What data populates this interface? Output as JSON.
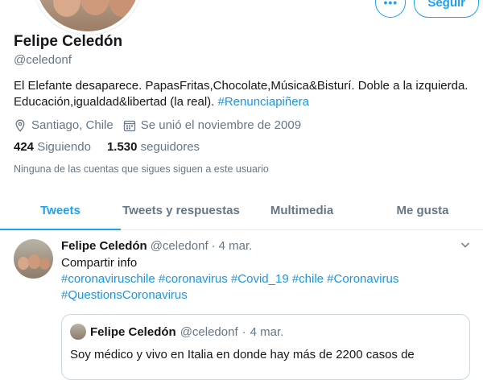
{
  "profile": {
    "name": "Felipe Celedón",
    "handle": "@celedonf",
    "bio_text": "El Elefante desaparece. PapasFritas,Chocolate,Música&Bisturí. Doble a la izquierda. Educación,igualdad&libertad (la real).",
    "bio_hashtag": "#Renunciapiñera",
    "location": "Santiago, Chile",
    "joined": "Se unió el noviembre de 2009",
    "following_count": "424",
    "following_label": "Siguiendo",
    "followers_count": "1.530",
    "followers_label": "seguidores",
    "followers_note": "Ninguna de las cuentas que sigues siguen a este usuario"
  },
  "actions": {
    "more_label": "•••",
    "follow_label": "Seguir"
  },
  "tabs": [
    {
      "label": "Tweets",
      "active": true
    },
    {
      "label": "Tweets y respuestas",
      "active": false
    },
    {
      "label": "Multimedia",
      "active": false
    },
    {
      "label": "Me gusta",
      "active": false
    }
  ],
  "tweet": {
    "name": "Felipe Celedón",
    "handle": "@celedonf",
    "separator": "·",
    "date": "4 mar.",
    "text": "Compartir info",
    "hashtags_line1": "#coronaviruschile #coronavirus #Covid_19 #chile #Coronavirus",
    "hashtags_line2": "#QuestionsCoronavirus",
    "quote": {
      "name": "Felipe Celedón",
      "handle": "@celedonf",
      "separator": "·",
      "date": "4 mar.",
      "text": "Soy médico y vivo en Italia en donde hay más de 2200 casos de"
    }
  },
  "colors": {
    "accent": "#1da1f2",
    "link": "#1b95e0",
    "muted": "#657786",
    "text": "#14171a",
    "border": "#e6ecf0"
  },
  "icons": [
    "location-pin-icon",
    "calendar-icon",
    "more-dots-icon",
    "chevron-down-icon"
  ]
}
